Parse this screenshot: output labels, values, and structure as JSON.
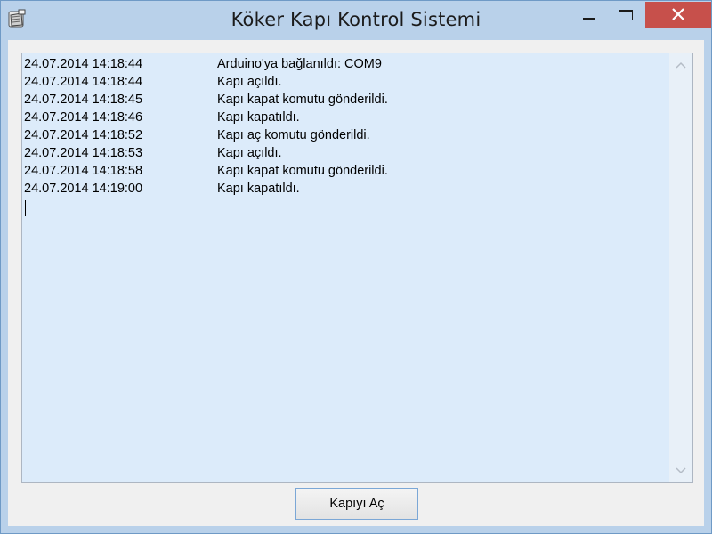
{
  "window": {
    "title": "Köker Kapı Kontrol Sistemi",
    "app_icon": "door-app-icon"
  },
  "title_buttons": {
    "minimize_icon": "minimize-icon",
    "maximize_icon": "maximize-icon",
    "close_icon": "close-icon"
  },
  "log": {
    "entries": [
      {
        "time": "24.07.2014 14:18:44",
        "message": "Arduino'ya bağlanıldı: COM9"
      },
      {
        "time": "24.07.2014 14:18:44",
        "message": "Kapı açıldı."
      },
      {
        "time": "24.07.2014 14:18:45",
        "message": "Kapı kapat komutu gönderildi."
      },
      {
        "time": "24.07.2014 14:18:46",
        "message": "Kapı kapatıldı."
      },
      {
        "time": "24.07.2014 14:18:52",
        "message": "Kapı aç komutu gönderildi."
      },
      {
        "time": "24.07.2014 14:18:53",
        "message": "Kapı açıldı."
      },
      {
        "time": "24.07.2014 14:18:58",
        "message": "Kapı kapat komutu gönderildi."
      },
      {
        "time": "24.07.2014 14:19:00",
        "message": "Kapı kapatıldı."
      }
    ]
  },
  "actions": {
    "open_door_label": "Kapıyı Aç"
  },
  "colors": {
    "frame": "#b9d1ea",
    "close_button": "#c7504b",
    "log_background": "#dcebfa"
  }
}
